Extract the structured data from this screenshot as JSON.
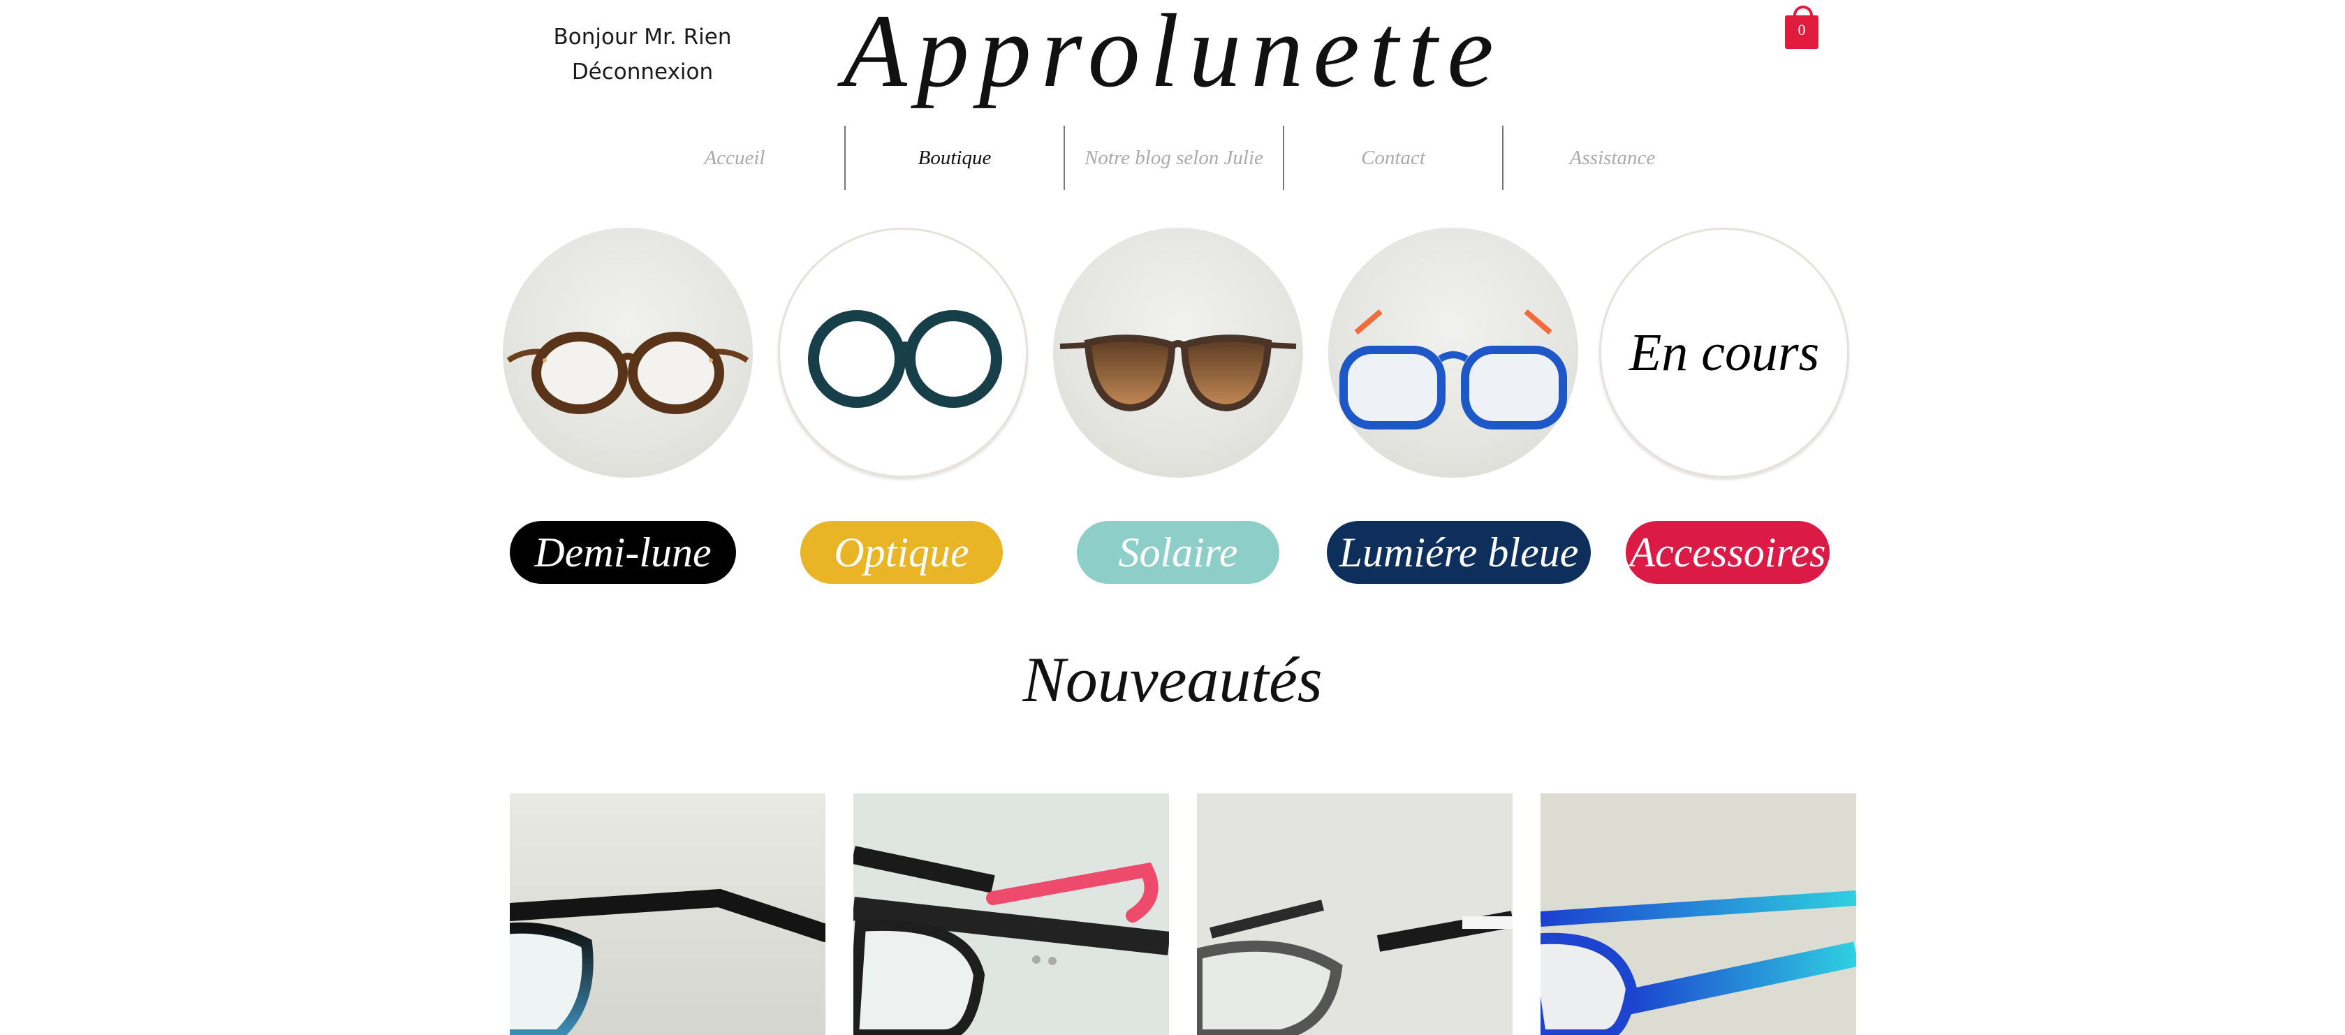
{
  "header": {
    "greeting": "Bonjour Mr. Rien",
    "logout": "Déconnexion",
    "logo": "Approlunette",
    "cart_count": "0"
  },
  "nav": {
    "items": [
      {
        "label": "Accueil"
      },
      {
        "label": "Boutique"
      },
      {
        "label": "Notre blog selon Julie"
      },
      {
        "label": "Contact"
      },
      {
        "label": "Assistance"
      }
    ]
  },
  "featured": {
    "last_circle_label": "En cours"
  },
  "categories": [
    {
      "label": "Demi-lune",
      "color": "#000000"
    },
    {
      "label": "Optique",
      "color": "#e9b526"
    },
    {
      "label": "Solaire",
      "color": "#8dcfc8"
    },
    {
      "label": "Lumiére bleue",
      "color": "#0e2f5c"
    },
    {
      "label": "Accessoires",
      "color": "#dc1a46"
    }
  ],
  "new_arrivals": {
    "title": "Nouveautés"
  },
  "colors": {
    "accent_red": "#e01b3e",
    "nav_inactive": "#aaaaaa"
  }
}
